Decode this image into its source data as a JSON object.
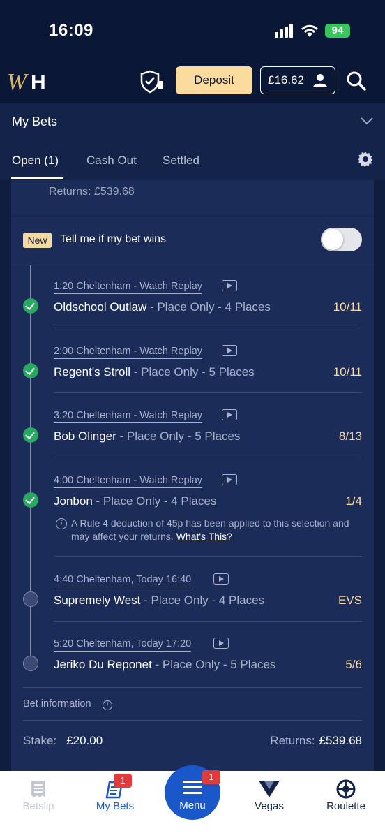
{
  "status": {
    "time": "16:09",
    "battery": "94"
  },
  "header": {
    "deposit_label": "Deposit",
    "balance": "£16.62"
  },
  "section": {
    "title": "My Bets"
  },
  "tabs": [
    {
      "label": "Open (1)"
    },
    {
      "label": "Cash Out"
    },
    {
      "label": "Settled"
    }
  ],
  "bet": {
    "returns_top": "Returns: £539.68",
    "new_badge": "New",
    "notify_label": "Tell me if my bet wins",
    "notify_enabled": false,
    "legs": [
      {
        "race": "1:20 Cheltenham - Watch Replay",
        "horse": "Oldschool Outlaw",
        "market": " - Place Only - 4 Places",
        "odds": "10/11",
        "status": "won"
      },
      {
        "race": "2:00 Cheltenham - Watch Replay",
        "horse": "Regent's Stroll",
        "market": " - Place Only - 5 Places",
        "odds": "10/11",
        "status": "won"
      },
      {
        "race": "3:20 Cheltenham - Watch Replay",
        "horse": "Bob Olinger",
        "market": " - Place Only - 5 Places",
        "odds": "8/13",
        "status": "won"
      },
      {
        "race": "4:00 Cheltenham - Watch Replay",
        "horse": "Jonbon",
        "market": " - Place Only - 4 Places",
        "odds": "1/4",
        "status": "won"
      },
      {
        "race_link": "4:40 Cheltenham",
        "race_time": ", Today 16:40",
        "horse": "Supremely West",
        "market": " - Place Only - 4 Places",
        "odds": "EVS",
        "status": "pending"
      },
      {
        "race_link": "5:20 Cheltenham",
        "race_time": ", Today 17:20",
        "horse": "Jeriko Du Reponet",
        "market": " - Place Only - 5 Places",
        "odds": "5/6",
        "status": "pending"
      }
    ],
    "rule4_text": "A Rule 4 deduction of 45p has been applied to this selection and may affect your returns.",
    "rule4_link": "What's This?",
    "bet_information_label": "Bet information",
    "stake_label": "Stake:",
    "stake_value": "£20.00",
    "returns_label": "Returns:",
    "returns_value": "£539.68"
  },
  "bottom_nav": {
    "betslip": "Betslip",
    "mybets": "My Bets",
    "mybets_badge": "1",
    "menu": "Menu",
    "menu_badge": "1",
    "vegas": "Vegas",
    "roulette": "Roulette"
  },
  "colors": {
    "accent": "#fbdc9e",
    "background": "#0f1d3f",
    "card": "#1c2c58",
    "success": "#28a860",
    "nav_active": "#1a57c9"
  }
}
